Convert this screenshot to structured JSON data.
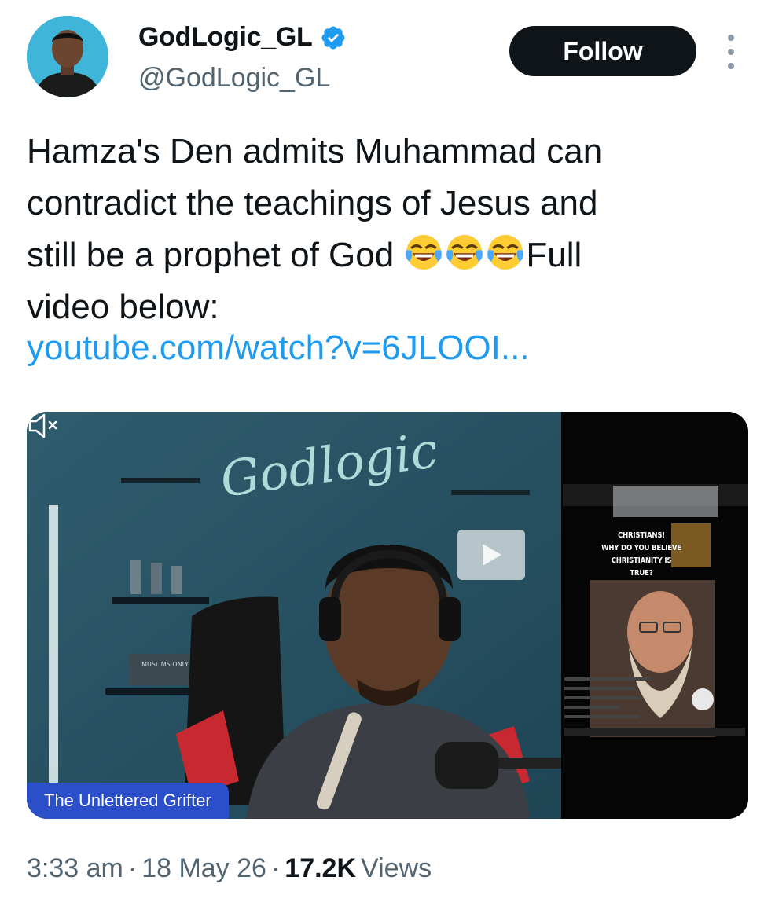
{
  "author": {
    "display_name": "GodLogic_GL",
    "handle": "@GodLogic_GL",
    "verified": true,
    "avatar_bg": "#3fb6d9"
  },
  "follow_label": "Follow",
  "tweet": {
    "line1": "Hamza's Den admits Muhammad can",
    "line2": "contradict the teachings of Jesus and",
    "line3_prefix": "still be a prophet of God ",
    "line3_suffix": "Full",
    "line4": "video below:",
    "emoji": "face-with-tears-of-joy",
    "emoji_count": 3,
    "link": "youtube.com/watch?v=6JLOOI..."
  },
  "media": {
    "wall_sign": "Godlogic",
    "shelf_sign": "MUSLIMS ONLY",
    "overlay_lines": [
      "CHRISTIANS!",
      "WHY DO YOU BELIEVE",
      "CHRISTIANITY IS TRUE?"
    ],
    "badge": "The Unlettered Grifter",
    "muted": true
  },
  "meta": {
    "time": "3:33 am",
    "date": "18 May 26",
    "views_count": "17.2K",
    "views_label": "Views",
    "separator": "·"
  },
  "colors": {
    "link": "#1d9bf0",
    "verified": "#1d9bf0",
    "badge": "#2a4fc9",
    "follow_bg": "#0f1419"
  }
}
